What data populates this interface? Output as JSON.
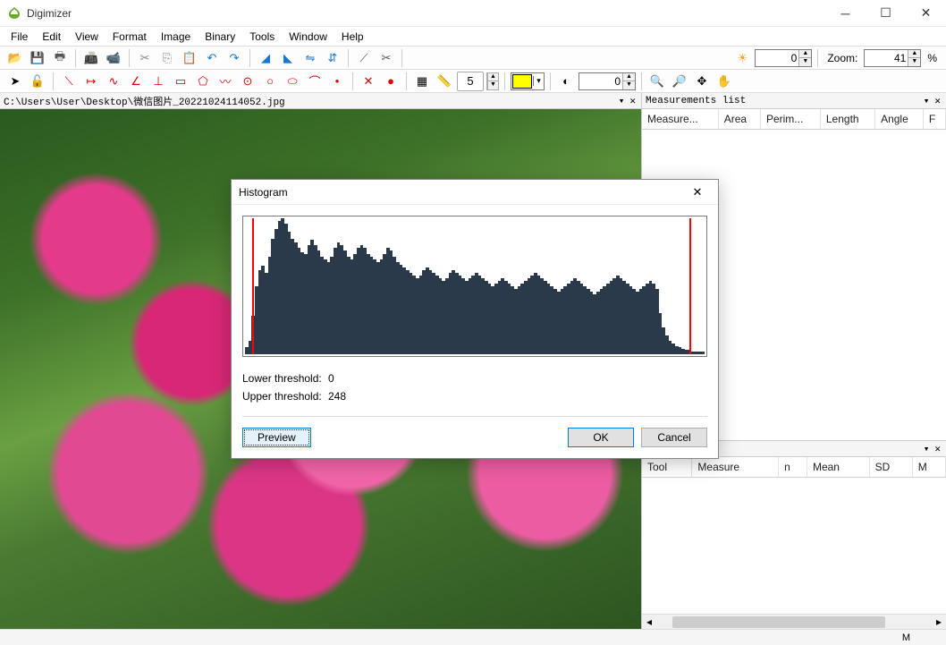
{
  "app": {
    "title": "Digimizer"
  },
  "menu": {
    "items": [
      "File",
      "Edit",
      "View",
      "Format",
      "Image",
      "Binary",
      "Tools",
      "Window",
      "Help"
    ]
  },
  "toolbar1": {
    "brightness": "0",
    "zoom_label": "Zoom:",
    "zoom_value": "41",
    "zoom_unit": "%",
    "contrast": "0"
  },
  "toolbar2": {
    "number": "5"
  },
  "left_panel": {
    "path": "C:\\Users\\User\\Desktop\\微信图片_20221024114052.jpg"
  },
  "right_panel1": {
    "title": "Measurements list",
    "columns": [
      "Measure...",
      "Area",
      "Perim...",
      "Length",
      "Angle",
      "F"
    ]
  },
  "right_panel2": {
    "columns": [
      "Tool",
      "Measure",
      "n",
      "Mean",
      "SD",
      "M"
    ]
  },
  "dialog": {
    "title": "Histogram",
    "lower_label": "Lower threshold:",
    "lower_value": "0",
    "upper_label": "Upper threshold:",
    "upper_value": "248",
    "preview": "Preview",
    "ok": "OK",
    "cancel": "Cancel"
  },
  "status": {
    "mode": "M"
  },
  "chart_data": {
    "type": "bar",
    "title": "Histogram",
    "xlabel": "",
    "ylabel": "",
    "categories_range": [
      0,
      255
    ],
    "lower_threshold": 0,
    "upper_threshold": 248,
    "values": [
      5,
      10,
      28,
      50,
      62,
      65,
      60,
      72,
      85,
      92,
      98,
      100,
      96,
      90,
      85,
      82,
      78,
      75,
      74,
      80,
      84,
      80,
      76,
      72,
      70,
      68,
      72,
      78,
      82,
      80,
      76,
      72,
      70,
      74,
      78,
      80,
      78,
      74,
      72,
      70,
      68,
      70,
      74,
      78,
      76,
      72,
      68,
      66,
      64,
      62,
      60,
      58,
      56,
      58,
      62,
      64,
      62,
      60,
      58,
      56,
      54,
      56,
      60,
      62,
      60,
      58,
      56,
      54,
      56,
      58,
      60,
      58,
      56,
      54,
      52,
      50,
      52,
      54,
      56,
      54,
      52,
      50,
      48,
      50,
      52,
      54,
      56,
      58,
      60,
      58,
      56,
      54,
      52,
      50,
      48,
      46,
      48,
      50,
      52,
      54,
      56,
      54,
      52,
      50,
      48,
      46,
      44,
      46,
      48,
      50,
      52,
      54,
      56,
      58,
      56,
      54,
      52,
      50,
      48,
      46,
      48,
      50,
      52,
      54,
      52,
      48,
      30,
      20,
      14,
      10,
      8,
      6,
      5,
      4,
      3,
      3,
      2,
      2,
      2,
      2
    ]
  }
}
